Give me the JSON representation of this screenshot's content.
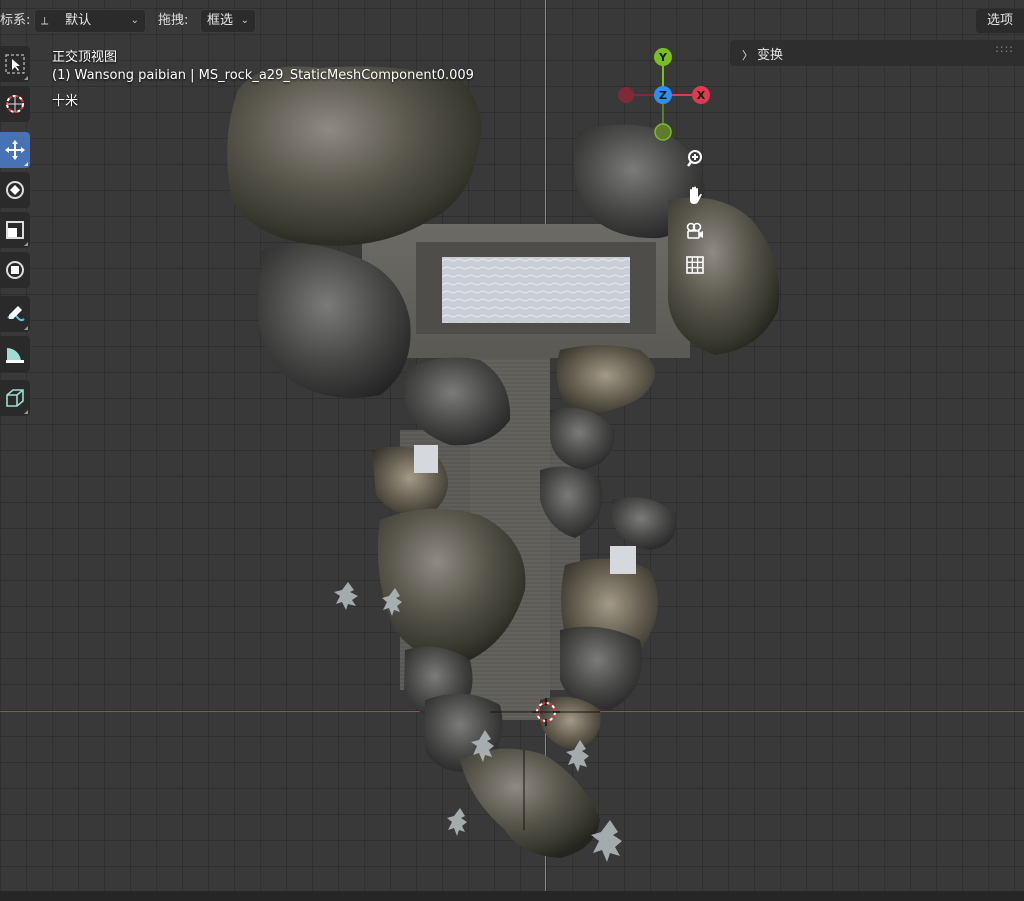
{
  "header": {
    "orientation_label": "标系:",
    "orientation_value": "默认",
    "drag_label": "拖拽:",
    "drag_value": "框选",
    "options_button": "选项"
  },
  "overlay": {
    "view_name": "正交顶视图",
    "object_info": "(1) Wansong paibian | MS_rock_a29_StaticMeshComponent0.009",
    "scale": "十米"
  },
  "npanel": {
    "transform_label": "变换"
  },
  "gizmo": {
    "x_label": "X",
    "y_label": "Y",
    "z_label": "Z",
    "colors": {
      "x": "#e1394e",
      "y": "#7bbf1e",
      "z": "#2c8fff"
    }
  },
  "toolbar": {
    "tools": [
      "select-box-tool",
      "cursor-tool",
      "move-tool",
      "rotate-tool",
      "scale-tool",
      "transform-tool",
      "annotate-tool",
      "measure-tool",
      "add-cube-tool"
    ],
    "active_tool": "move-tool"
  },
  "nav_controls": [
    "zoom-icon",
    "pan-hand-icon",
    "camera-icon",
    "grid-icon"
  ],
  "colors": {
    "accent": "#4772b3",
    "x_axis": "#b0444b",
    "y_axis": "#6aa33a"
  }
}
